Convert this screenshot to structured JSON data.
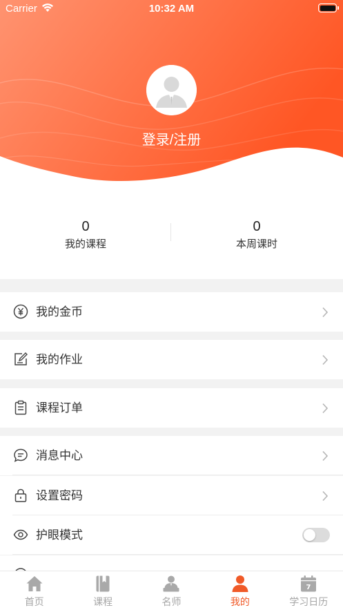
{
  "status_bar": {
    "carrier": "Carrier",
    "time": "10:32 AM"
  },
  "profile": {
    "login_label": "登录/注册"
  },
  "stats": [
    {
      "value": "0",
      "label": "我的课程"
    },
    {
      "value": "0",
      "label": "本周课时"
    }
  ],
  "menu": {
    "coins": "我的金币",
    "homework": "我的作业",
    "orders": "课程订单",
    "messages": "消息中心",
    "password": "设置密码",
    "eye_mode": "护眼模式",
    "eye_mode_enabled": false
  },
  "tabs": [
    {
      "label": "首页",
      "icon": "home-icon",
      "active": false
    },
    {
      "label": "课程",
      "icon": "book-icon",
      "active": false
    },
    {
      "label": "名师",
      "icon": "teacher-icon",
      "active": false
    },
    {
      "label": "我的",
      "icon": "person-icon",
      "active": true
    },
    {
      "label": "学习日历",
      "icon": "calendar-icon",
      "active": false
    }
  ],
  "colors": {
    "accent": "#f05a28",
    "gradient_start": "#ff8a62",
    "gradient_end": "#ff5a28",
    "inactive": "#a6a6a6"
  }
}
